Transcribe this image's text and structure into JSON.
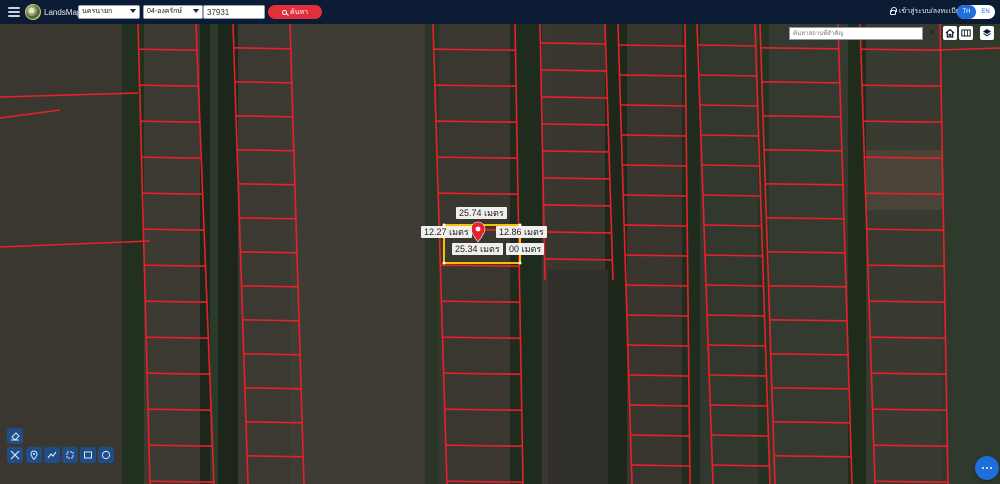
{
  "header": {
    "brand": "LandsMaps",
    "province_select": "นครนายก",
    "district_select": "04-องครักษ์",
    "parcel_number": "37931",
    "search_label": "ค้นหา",
    "login_label": "เข้าสู่ระบบ/ลงทะเบียน",
    "lang_th": "TH",
    "lang_en": "EN"
  },
  "map_search": {
    "placeholder": "ค้นหาสถานที่สำคัญ",
    "clear": "×"
  },
  "measurements": {
    "top": "25.74 เมตร",
    "left": "12.27 เมตร",
    "right": "12.86 เมตร",
    "bottom": "25.34 เมตร",
    "area_fragment": "00 เมตร"
  },
  "colors": {
    "topbar": "#0b1b33",
    "parcel_lines": "#e8202a",
    "selected_parcel": "#f2c200",
    "search_button": "#e0303a",
    "accent": "#1e6fd9",
    "tool_buttons": "#1f4e86"
  },
  "icons": {
    "menu": "hamburger-icon",
    "home": "home-icon",
    "table": "table-icon",
    "layers": "layers-icon",
    "eraser": "eraser-icon",
    "measure_cross": "crosshair-icon",
    "marker": "marker-icon",
    "polyline": "polyline-icon",
    "polygon": "polygon-icon",
    "rectangle": "rectangle-icon",
    "circle": "circle-icon",
    "more": "more-icon"
  }
}
